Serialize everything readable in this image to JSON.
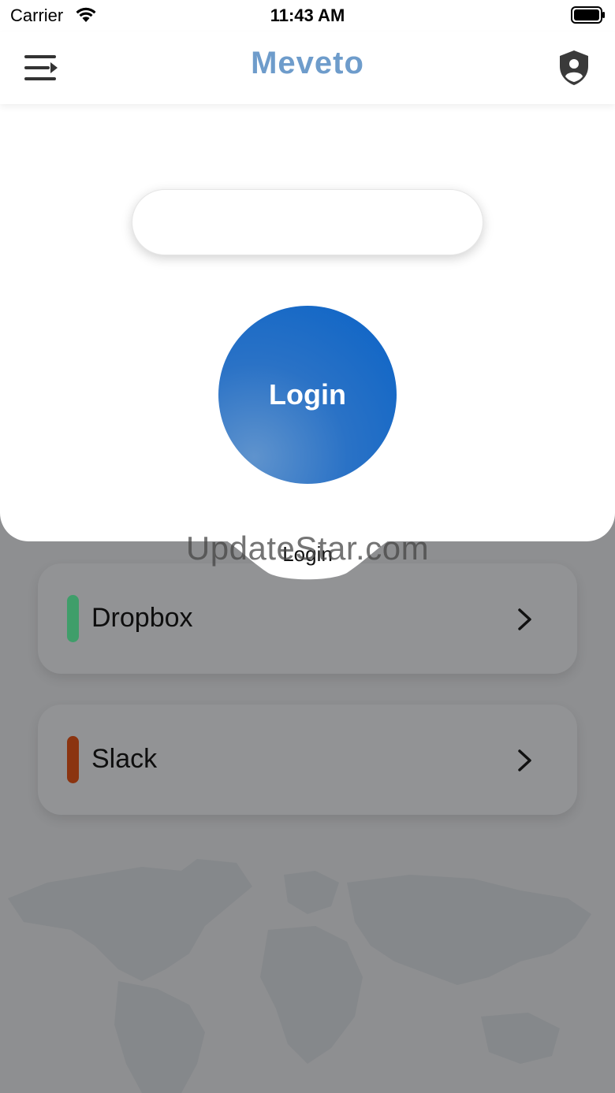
{
  "status_bar": {
    "carrier": "Carrier",
    "time": "11:43 AM"
  },
  "nav": {
    "logo_text": "Meveto",
    "menu_icon": "menu-arrow-icon",
    "profile_icon": "shield-user-icon"
  },
  "login": {
    "input_value": "",
    "button_label": "Login",
    "tab_label": "Login"
  },
  "services": [
    {
      "label": "Dropbox",
      "color": "#3f9e6a"
    },
    {
      "label": "Slack",
      "color": "#8b3410"
    }
  ],
  "watermark": "UpdateStar.com",
  "colors": {
    "accent": "#0a63c7",
    "logo": "#6e9ccb"
  }
}
